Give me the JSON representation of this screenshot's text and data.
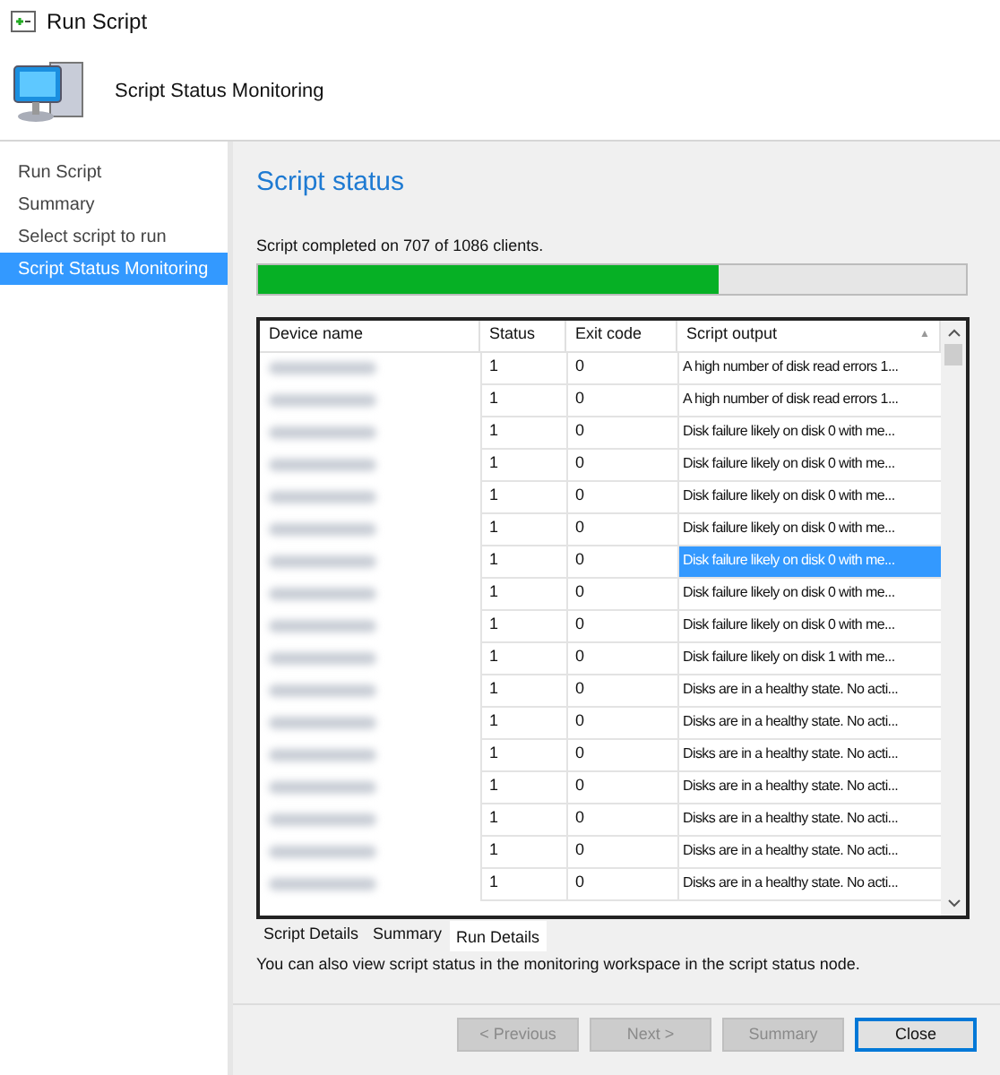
{
  "window": {
    "title": "Run Script"
  },
  "header": {
    "title": "Script Status Monitoring"
  },
  "sidebar": {
    "items": [
      {
        "label": "Run Script",
        "selected": false
      },
      {
        "label": "Summary",
        "selected": false
      },
      {
        "label": "Select script to run",
        "selected": false
      },
      {
        "label": "Script Status Monitoring",
        "selected": true
      }
    ]
  },
  "content": {
    "heading": "Script status",
    "progress_text": "Script completed on 707 of 1086 clients.",
    "progress": {
      "level": 0.651
    }
  },
  "table": {
    "columns": [
      {
        "label": "Device name"
      },
      {
        "label": "Status"
      },
      {
        "label": "Exit code"
      },
      {
        "label": "Script output",
        "sort": "▲"
      }
    ],
    "rows": [
      {
        "status": "1",
        "exit_code": "0",
        "output": "A high number of disk read errors 1...",
        "selected": false
      },
      {
        "status": "1",
        "exit_code": "0",
        "output": "A high number of disk read errors 1...",
        "selected": false
      },
      {
        "status": "1",
        "exit_code": "0",
        "output": "Disk failure likely on disk 0 with me...",
        "selected": false
      },
      {
        "status": "1",
        "exit_code": "0",
        "output": "Disk failure likely on disk 0 with me...",
        "selected": false
      },
      {
        "status": "1",
        "exit_code": "0",
        "output": "Disk failure likely on disk 0 with me...",
        "selected": false
      },
      {
        "status": "1",
        "exit_code": "0",
        "output": "Disk failure likely on disk 0 with me...",
        "selected": false
      },
      {
        "status": "1",
        "exit_code": "0",
        "output": "Disk failure likely on disk 0 with me...",
        "selected": true
      },
      {
        "status": "1",
        "exit_code": "0",
        "output": "Disk failure likely on disk 0 with me...",
        "selected": false
      },
      {
        "status": "1",
        "exit_code": "0",
        "output": "Disk failure likely on disk 0 with me...",
        "selected": false
      },
      {
        "status": "1",
        "exit_code": "0",
        "output": "Disk failure likely on disk 1 with me...",
        "selected": false
      },
      {
        "status": "1",
        "exit_code": "0",
        "output": "Disks are in a healthy state. No acti...",
        "selected": false
      },
      {
        "status": "1",
        "exit_code": "0",
        "output": "Disks are in a healthy state. No acti...",
        "selected": false
      },
      {
        "status": "1",
        "exit_code": "0",
        "output": "Disks are in a healthy state. No acti...",
        "selected": false
      },
      {
        "status": "1",
        "exit_code": "0",
        "output": "Disks are in a healthy state. No acti...",
        "selected": false
      },
      {
        "status": "1",
        "exit_code": "0",
        "output": "Disks are in a healthy state. No acti...",
        "selected": false
      },
      {
        "status": "1",
        "exit_code": "0",
        "output": "Disks are in a healthy state. No acti...",
        "selected": false
      },
      {
        "status": "1",
        "exit_code": "0",
        "output": "Disks are in a healthy state. No acti...",
        "selected": false
      }
    ]
  },
  "tabs": [
    {
      "label": "Script Details",
      "selected": false
    },
    {
      "label": "Summary",
      "selected": false
    },
    {
      "label": "Run Details",
      "selected": true
    }
  ],
  "note": "You can also view script status in the monitoring workspace in the script status node.",
  "buttons": [
    {
      "label": "< Previous",
      "disabled": true
    },
    {
      "label": "Next >",
      "disabled": true
    },
    {
      "label": "Summary",
      "disabled": true
    },
    {
      "label": "Close",
      "disabled": false
    }
  ]
}
